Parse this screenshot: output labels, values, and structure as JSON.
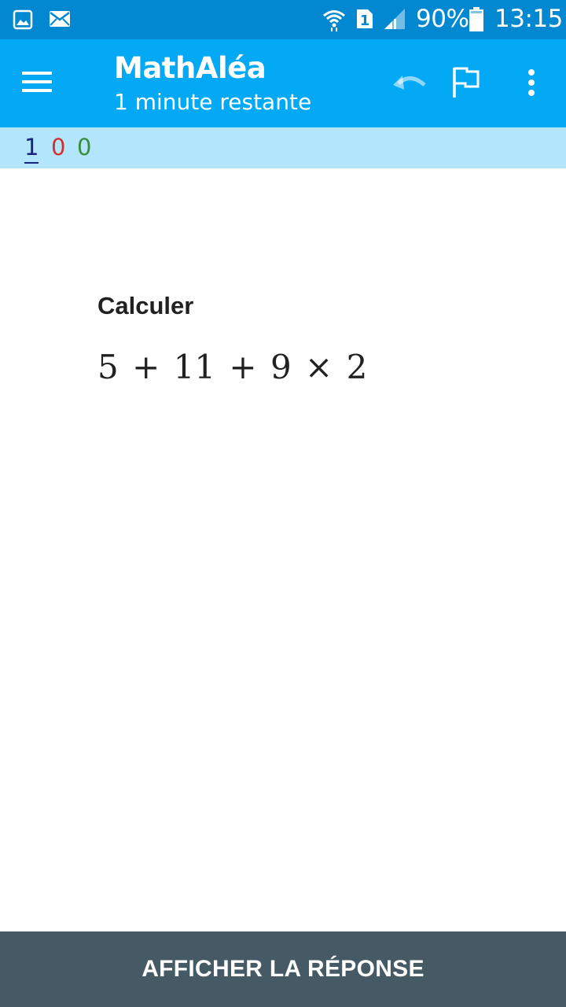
{
  "status_bar": {
    "left_icons": [
      "image-icon",
      "mail-icon"
    ],
    "right_icons": [
      "wifi-icon",
      "sim-1-icon",
      "signal-icon",
      "battery-icon"
    ],
    "battery": "90%",
    "time": "13:15",
    "color": "#0288d1"
  },
  "app_bar": {
    "title": "MathAléa",
    "subtitle": "1 minute restante",
    "color": "#03a9f4",
    "icons": [
      "menu-icon",
      "undo-icon",
      "flag-icon",
      "more-vert-icon"
    ]
  },
  "scores": {
    "current": "1",
    "wrong": "0",
    "right": "0",
    "colors": {
      "current": "#1a237e",
      "wrong": "#d32f2f",
      "right": "#388e3c"
    }
  },
  "question": {
    "instruction": "Calculer",
    "expression": "5 + 11 + 9 × 2"
  },
  "footer": {
    "button_label": "AFFICHER LA RÉPONSE",
    "color": "#455a64"
  }
}
